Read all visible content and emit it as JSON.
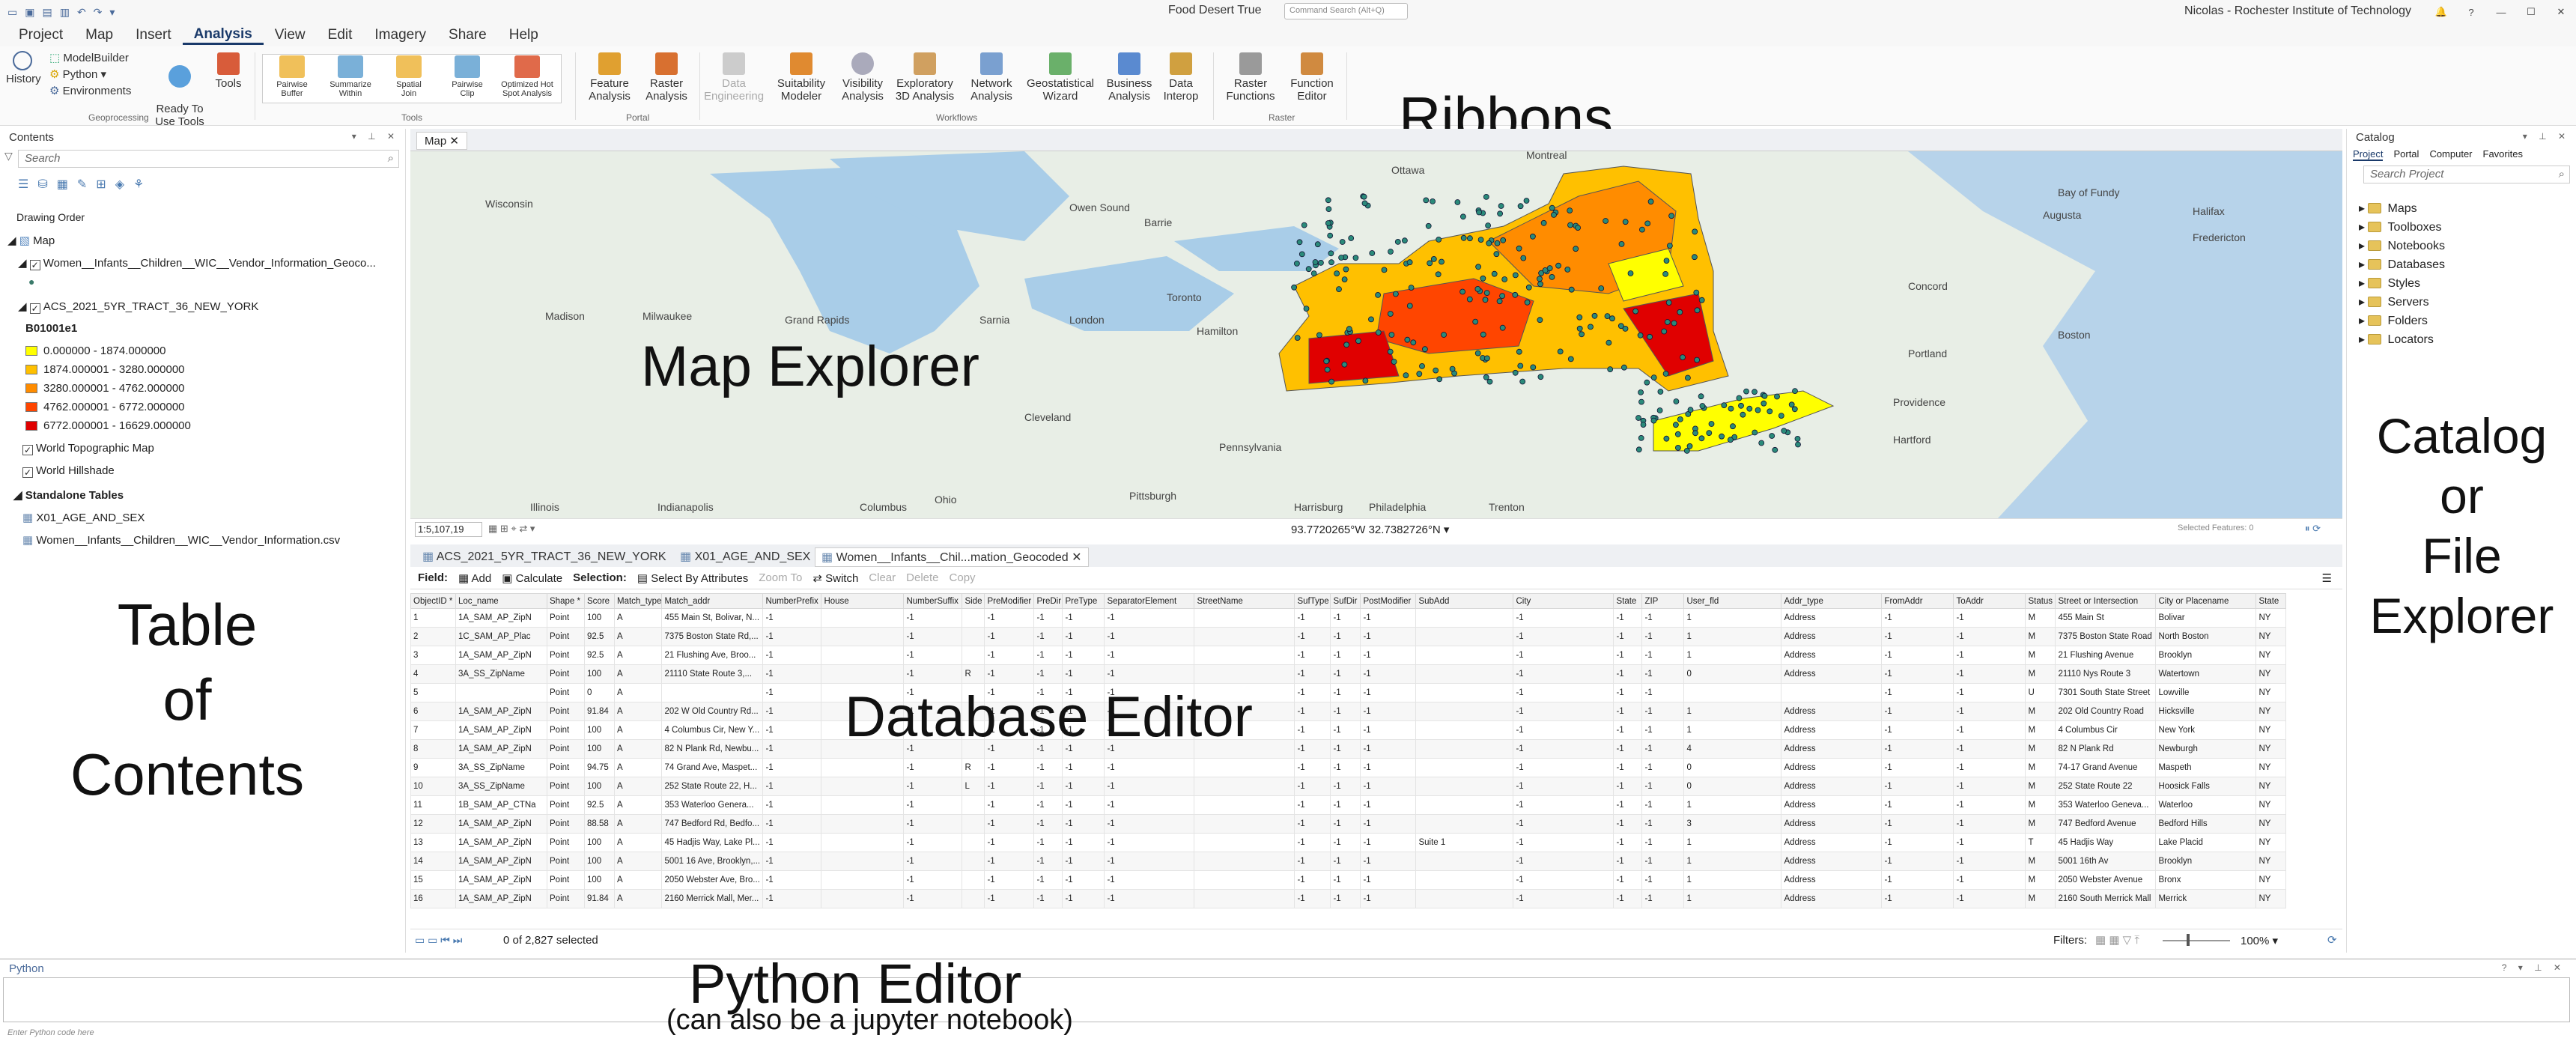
{
  "window": {
    "title": "Food Desert True",
    "command_search": "Command Search (Alt+Q)",
    "user": "Nicolas - Rochester Institute of Technology"
  },
  "menu": [
    "Project",
    "Map",
    "Insert",
    "Analysis",
    "View",
    "Edit",
    "Imagery",
    "Share",
    "Help"
  ],
  "ribbon": {
    "history": "History",
    "modelbuilder": "ModelBuilder",
    "python": "Python",
    "environments": "Environments",
    "ready_to_use": "Ready To\nUse Tools",
    "tools": "Tools",
    "geoprocessing": "Geoprocessing",
    "tool_gallery": [
      "Pairwise\nBuffer",
      "Summarize\nWithin",
      "Spatial\nJoin",
      "Pairwise\nClip",
      "Optimized Hot\nSpot Analysis"
    ],
    "tools_group": "Tools",
    "feature_analysis": "Feature\nAnalysis",
    "raster_analysis": "Raster\nAnalysis",
    "portal": "Portal",
    "workflows": [
      "Data\nEngineering",
      "Suitability\nModeler",
      "Visibility\nAnalysis",
      "Exploratory\n3D Analysis",
      "Network\nAnalysis",
      "Geostatistical\nWizard",
      "Business\nAnalysis",
      "Data\nInterop"
    ],
    "workflows_group": "Workflows",
    "raster_functions": "Raster\nFunctions",
    "function_editor": "Function\nEditor",
    "raster_group": "Raster"
  },
  "annotations": {
    "ribbons": "Ribbons",
    "map_explorer": "Map Explorer",
    "toc": [
      "Table",
      "of",
      "Contents"
    ],
    "database_editor": "Database Editor",
    "catalog": [
      "Catalog",
      "or",
      "File",
      "Explorer"
    ],
    "python_editor": "Python Editor",
    "python_sub": "(can also be a jupyter notebook)"
  },
  "contents": {
    "title": "Contents",
    "search": "Search",
    "drawing_order": "Drawing Order",
    "map": "Map",
    "layers": {
      "wic": "Women__Infants__Children__WIC__Vendor_Information_Geoco...",
      "acs": "ACS_2021_5YR_TRACT_36_NEW_YORK",
      "field": "B01001e1",
      "classes": [
        "0.000000 - 1874.000000",
        "1874.000001 - 3280.000000",
        "3280.000001 - 4762.000000",
        "4762.000001 - 6772.000000",
        "6772.000001 - 16629.000000"
      ],
      "class_colors": [
        "#ffff00",
        "#ffc000",
        "#ff8c00",
        "#ff4500",
        "#e00000"
      ],
      "topo": "World Topographic Map",
      "hillshade": "World Hillshade"
    },
    "standalone": "Standalone Tables",
    "tables": [
      "X01_AGE_AND_SEX",
      "Women__Infants__Children__WIC__Vendor_Information.csv"
    ]
  },
  "map": {
    "tab": "Map",
    "scale": "1:5,107,19",
    "coords": "93.7720265°W 32.7382726°N",
    "selected_features": "Selected Features: 0",
    "places": [
      "Ottawa",
      "Montreal",
      "Wisconsin",
      "Owen Sound",
      "Barrie",
      "Augusta",
      "Halifax",
      "Madison",
      "Milwaukee",
      "Grand Rapids",
      "Sarnia",
      "London",
      "Toronto",
      "Hamilton",
      "Concord",
      "Portland",
      "Boston",
      "Providence",
      "Hartford",
      "Cleveland",
      "Pittsburgh",
      "Pennsylvania",
      "Ohio",
      "Illinois",
      "Indianapolis",
      "Columbus",
      "Harrisburg",
      "Philadelphia",
      "Trenton",
      "Bay of Fundy",
      "Fredericton"
    ]
  },
  "table": {
    "tabs": [
      "ACS_2021_5YR_TRACT_36_NEW_YORK",
      "X01_AGE_AND_SEX",
      "Women__Infants__Chil...mation_Geocoded"
    ],
    "toolbar": {
      "field": "Field:",
      "add": "Add",
      "calculate": "Calculate",
      "selection": "Selection:",
      "select_by_attr": "Select By Attributes",
      "zoom_to": "Zoom To",
      "switch": "Switch",
      "clear": "Clear",
      "delete": "Delete",
      "copy": "Copy"
    },
    "columns": [
      "ObjectID *",
      "Loc_name",
      "Shape *",
      "Score",
      "Match_type",
      "Match_addr",
      "NumberPrefix",
      "House",
      "NumberSuffix",
      "Side",
      "PreModifier",
      "PreDir",
      "PreType",
      "SeparatorElement",
      "StreetName",
      "SufType",
      "SufDir",
      "PostModifier",
      "SubAdd",
      "City",
      "State",
      "ZIP",
      "User_fld",
      "Addr_type",
      "FromAddr",
      "ToAddr",
      "Status",
      "Street or Intersection",
      "City or Placename",
      "State"
    ],
    "rows": [
      [
        "1",
        "1A_SAM_AP_ZipN",
        "Point",
        "100",
        "A",
        "455 Main St, Bolivar, N...",
        "-1",
        "",
        "-1",
        "",
        "-1",
        "-1",
        "-1",
        "-1",
        "",
        "-1",
        "-1",
        "-1",
        "",
        "-1",
        "-1",
        "-1",
        "1",
        "Address",
        "-1",
        "-1",
        "M",
        "455 Main St",
        "Bolivar",
        "NY"
      ],
      [
        "2",
        "1C_SAM_AP_Plac",
        "Point",
        "92.5",
        "A",
        "7375 Boston State Rd,...",
        "-1",
        "",
        "-1",
        "",
        "-1",
        "-1",
        "-1",
        "-1",
        "",
        "-1",
        "-1",
        "-1",
        "",
        "-1",
        "-1",
        "-1",
        "1",
        "Address",
        "-1",
        "-1",
        "M",
        "7375 Boston State Road",
        "North Boston",
        "NY"
      ],
      [
        "3",
        "1A_SAM_AP_ZipN",
        "Point",
        "92.5",
        "A",
        "21 Flushing Ave, Broo...",
        "-1",
        "",
        "-1",
        "",
        "-1",
        "-1",
        "-1",
        "-1",
        "",
        "-1",
        "-1",
        "-1",
        "",
        "-1",
        "-1",
        "-1",
        "1",
        "Address",
        "-1",
        "-1",
        "M",
        "21 Flushing Avenue",
        "Brooklyn",
        "NY"
      ],
      [
        "4",
        "3A_SS_ZipName",
        "Point",
        "100",
        "A",
        "21110 State Route 3,...",
        "-1",
        "",
        "-1",
        "R",
        "-1",
        "-1",
        "-1",
        "-1",
        "",
        "-1",
        "-1",
        "-1",
        "",
        "-1",
        "-1",
        "-1",
        "0",
        "Address",
        "-1",
        "-1",
        "M",
        "21110 Nys Route 3",
        "Watertown",
        "NY"
      ],
      [
        "5",
        "",
        "Point",
        "0",
        "A",
        "",
        "-1",
        "",
        "-1",
        "",
        "-1",
        "-1",
        "-1",
        "-1",
        "",
        "-1",
        "-1",
        "-1",
        "",
        "-1",
        "-1",
        "-1",
        "",
        "",
        "-1",
        "-1",
        "U",
        "7301 South State Street",
        "Lowville",
        "NY"
      ],
      [
        "6",
        "1A_SAM_AP_ZipN",
        "Point",
        "91.84",
        "A",
        "202 W Old Country Rd...",
        "-1",
        "",
        "-1",
        "",
        "-1",
        "-1",
        "-1",
        "-1",
        "",
        "-1",
        "-1",
        "-1",
        "",
        "-1",
        "-1",
        "-1",
        "1",
        "Address",
        "-1",
        "-1",
        "M",
        "202 Old Country Road",
        "Hicksville",
        "NY"
      ],
      [
        "7",
        "1A_SAM_AP_ZipN",
        "Point",
        "100",
        "A",
        "4 Columbus Cir, New Y...",
        "-1",
        "",
        "-1",
        "",
        "-1",
        "-1",
        "-1",
        "-1",
        "",
        "-1",
        "-1",
        "-1",
        "",
        "-1",
        "-1",
        "-1",
        "1",
        "Address",
        "-1",
        "-1",
        "M",
        "4 Columbus Cir",
        "New York",
        "NY"
      ],
      [
        "8",
        "1A_SAM_AP_ZipN",
        "Point",
        "100",
        "A",
        "82 N Plank Rd, Newbu...",
        "-1",
        "",
        "-1",
        "",
        "-1",
        "-1",
        "-1",
        "-1",
        "",
        "-1",
        "-1",
        "-1",
        "",
        "-1",
        "-1",
        "-1",
        "4",
        "Address",
        "-1",
        "-1",
        "M",
        "82 N Plank Rd",
        "Newburgh",
        "NY"
      ],
      [
        "9",
        "3A_SS_ZipName",
        "Point",
        "94.75",
        "A",
        "74 Grand Ave, Maspet...",
        "-1",
        "",
        "-1",
        "R",
        "-1",
        "-1",
        "-1",
        "-1",
        "",
        "-1",
        "-1",
        "-1",
        "",
        "-1",
        "-1",
        "-1",
        "0",
        "Address",
        "-1",
        "-1",
        "M",
        "74-17 Grand Avenue",
        "Maspeth",
        "NY"
      ],
      [
        "10",
        "3A_SS_ZipName",
        "Point",
        "100",
        "A",
        "252 State Route 22, H...",
        "-1",
        "",
        "-1",
        "L",
        "-1",
        "-1",
        "-1",
        "-1",
        "",
        "-1",
        "-1",
        "-1",
        "",
        "-1",
        "-1",
        "-1",
        "0",
        "Address",
        "-1",
        "-1",
        "M",
        "252 State Route 22",
        "Hoosick Falls",
        "NY"
      ],
      [
        "11",
        "1B_SAM_AP_CTNa",
        "Point",
        "92.5",
        "A",
        "353 Waterloo Genera...",
        "-1",
        "",
        "-1",
        "",
        "-1",
        "-1",
        "-1",
        "-1",
        "",
        "-1",
        "-1",
        "-1",
        "",
        "-1",
        "-1",
        "-1",
        "1",
        "Address",
        "-1",
        "-1",
        "M",
        "353 Waterloo Geneva...",
        "Waterloo",
        "NY"
      ],
      [
        "12",
        "1A_SAM_AP_ZipN",
        "Point",
        "88.58",
        "A",
        "747 Bedford Rd, Bedfo...",
        "-1",
        "",
        "-1",
        "",
        "-1",
        "-1",
        "-1",
        "-1",
        "",
        "-1",
        "-1",
        "-1",
        "",
        "-1",
        "-1",
        "-1",
        "3",
        "Address",
        "-1",
        "-1",
        "M",
        "747 Bedford Avenue",
        "Bedford Hills",
        "NY"
      ],
      [
        "13",
        "1A_SAM_AP_ZipN",
        "Point",
        "100",
        "A",
        "45 Hadjis Way, Lake Pl...",
        "-1",
        "",
        "-1",
        "",
        "-1",
        "-1",
        "-1",
        "-1",
        "",
        "-1",
        "-1",
        "-1",
        "Suite 1",
        "-1",
        "-1",
        "-1",
        "1",
        "Address",
        "-1",
        "-1",
        "T",
        "45 Hadjis Way",
        "Lake Placid",
        "NY"
      ],
      [
        "14",
        "1A_SAM_AP_ZipN",
        "Point",
        "100",
        "A",
        "5001 16 Ave, Brooklyn,...",
        "-1",
        "",
        "-1",
        "",
        "-1",
        "-1",
        "-1",
        "-1",
        "",
        "-1",
        "-1",
        "-1",
        "",
        "-1",
        "-1",
        "-1",
        "1",
        "Address",
        "-1",
        "-1",
        "M",
        "5001 16th Av",
        "Brooklyn",
        "NY"
      ],
      [
        "15",
        "1A_SAM_AP_ZipN",
        "Point",
        "100",
        "A",
        "2050 Webster Ave, Bro...",
        "-1",
        "",
        "-1",
        "",
        "-1",
        "-1",
        "-1",
        "-1",
        "",
        "-1",
        "-1",
        "-1",
        "",
        "-1",
        "-1",
        "-1",
        "1",
        "Address",
        "-1",
        "-1",
        "M",
        "2050 Webster Avenue",
        "Bronx",
        "NY"
      ],
      [
        "16",
        "1A_SAM_AP_ZipN",
        "Point",
        "91.84",
        "A",
        "2160 Merrick Mall, Mer...",
        "-1",
        "",
        "-1",
        "",
        "-1",
        "-1",
        "-1",
        "-1",
        "",
        "-1",
        "-1",
        "-1",
        "",
        "-1",
        "-1",
        "-1",
        "1",
        "Address",
        "-1",
        "-1",
        "M",
        "2160 South Merrick Mall",
        "Merrick",
        "NY"
      ]
    ],
    "status": "0 of 2,827 selected",
    "filters": "Filters:",
    "zoom": "100%"
  },
  "catalog": {
    "title": "Catalog",
    "tabs": [
      "Project",
      "Portal",
      "Computer",
      "Favorites"
    ],
    "search": "Search Project",
    "items": [
      "Maps",
      "Toolboxes",
      "Notebooks",
      "Databases",
      "Styles",
      "Servers",
      "Folders",
      "Locators"
    ]
  },
  "python": {
    "title": "Python",
    "placeholder": "Enter Python code here"
  }
}
